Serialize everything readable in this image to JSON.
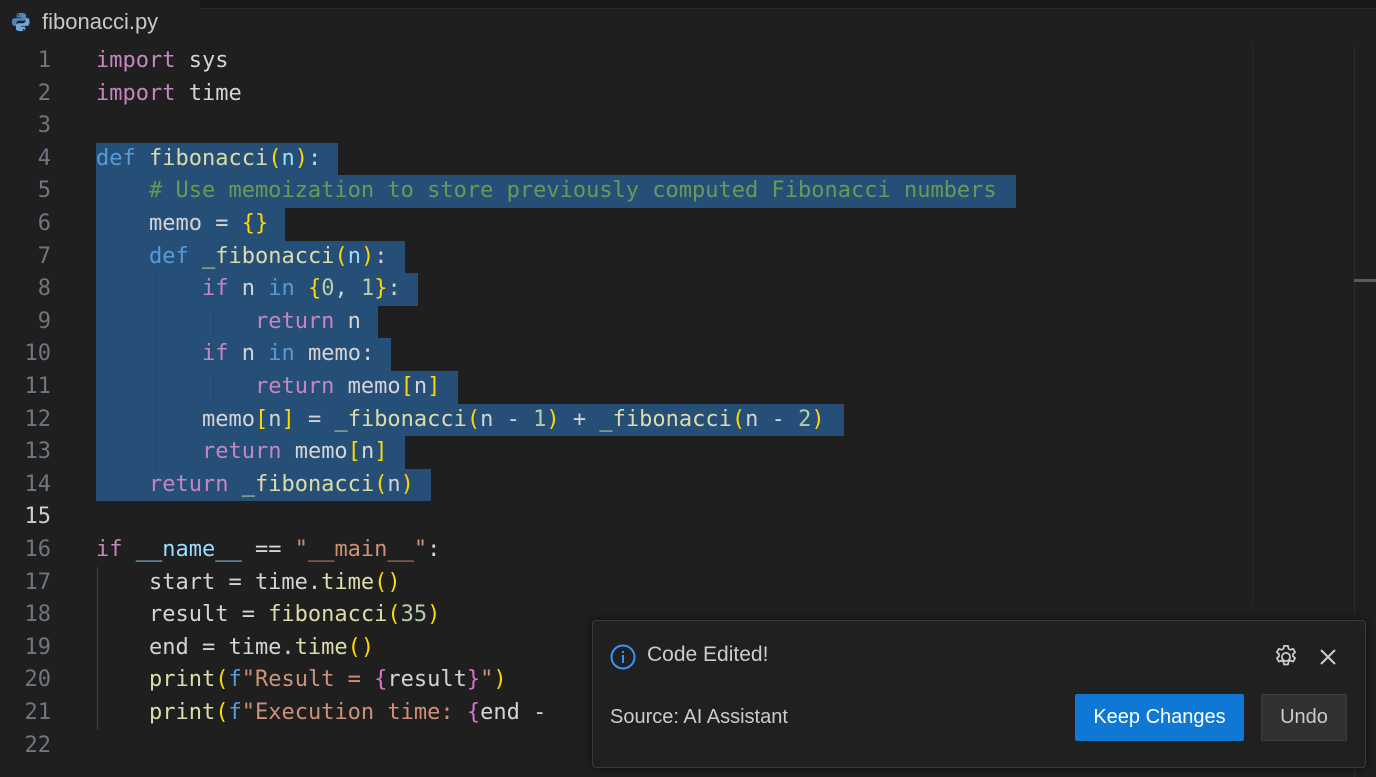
{
  "tab": {
    "filename": "fibonacci.py",
    "icon": "python-file-icon"
  },
  "editor": {
    "active_line": 15,
    "lines": [
      {
        "n": "1",
        "tokens": [
          [
            "kw",
            "import"
          ],
          [
            "",
            "&nbsp;sys"
          ]
        ]
      },
      {
        "n": "2",
        "tokens": [
          [
            "kw",
            "import"
          ],
          [
            "",
            "&nbsp;time"
          ]
        ]
      },
      {
        "n": "3",
        "tokens": []
      },
      {
        "n": "4",
        "tokens": [
          [
            "kwb",
            "def"
          ],
          [
            "",
            ""
          ],
          [
            "fn",
            "&nbsp;fibonacci"
          ],
          [
            "br1",
            "("
          ],
          [
            "var",
            "n"
          ],
          [
            "br1",
            ")"
          ],
          [
            "",
            ":"
          ]
        ]
      },
      {
        "n": "5",
        "tokens": [
          [
            "cm",
            "&nbsp;&nbsp;&nbsp;&nbsp;# Use memoization to store previously computed Fibonacci numbers"
          ]
        ]
      },
      {
        "n": "6",
        "tokens": [
          [
            "",
            "&nbsp;&nbsp;&nbsp;&nbsp;memo = "
          ],
          [
            "br1",
            "{}"
          ]
        ]
      },
      {
        "n": "7",
        "tokens": [
          [
            "",
            "&nbsp;&nbsp;&nbsp;&nbsp;"
          ],
          [
            "kwb",
            "def"
          ],
          [
            "fn",
            "&nbsp;_fibonacci"
          ],
          [
            "br1",
            "("
          ],
          [
            "var",
            "n"
          ],
          [
            "br1",
            ")"
          ],
          [
            "",
            ":"
          ]
        ]
      },
      {
        "n": "8",
        "tokens": [
          [
            "",
            "&nbsp;&nbsp;&nbsp;&nbsp;&nbsp;&nbsp;&nbsp;&nbsp;"
          ],
          [
            "kw",
            "if"
          ],
          [
            "",
            "&nbsp;n&nbsp;"
          ],
          [
            "kwb",
            "in"
          ],
          [
            "",
            "&nbsp;"
          ],
          [
            "br1",
            "{"
          ],
          [
            "num",
            "0"
          ],
          [
            "",
            ",&nbsp;"
          ],
          [
            "num",
            "1"
          ],
          [
            "br1",
            "}"
          ],
          [
            "",
            ":"
          ]
        ]
      },
      {
        "n": "9",
        "tokens": [
          [
            "",
            "&nbsp;&nbsp;&nbsp;&nbsp;&nbsp;&nbsp;&nbsp;&nbsp;&nbsp;&nbsp;&nbsp;&nbsp;"
          ],
          [
            "kw",
            "return"
          ],
          [
            "",
            "&nbsp;n"
          ]
        ]
      },
      {
        "n": "10",
        "tokens": [
          [
            "",
            "&nbsp;&nbsp;&nbsp;&nbsp;&nbsp;&nbsp;&nbsp;&nbsp;"
          ],
          [
            "kw",
            "if"
          ],
          [
            "",
            "&nbsp;n&nbsp;"
          ],
          [
            "kwb",
            "in"
          ],
          [
            "",
            "&nbsp;memo:"
          ]
        ]
      },
      {
        "n": "11",
        "tokens": [
          [
            "",
            "&nbsp;&nbsp;&nbsp;&nbsp;&nbsp;&nbsp;&nbsp;&nbsp;&nbsp;&nbsp;&nbsp;&nbsp;"
          ],
          [
            "kw",
            "return"
          ],
          [
            "",
            "&nbsp;memo"
          ],
          [
            "br1",
            "["
          ],
          [
            "",
            "n"
          ],
          [
            "br1",
            "]"
          ]
        ]
      },
      {
        "n": "12",
        "tokens": [
          [
            "",
            "&nbsp;&nbsp;&nbsp;&nbsp;&nbsp;&nbsp;&nbsp;&nbsp;memo"
          ],
          [
            "br1",
            "["
          ],
          [
            "",
            "n"
          ],
          [
            "br1",
            "]"
          ],
          [
            "",
            "&nbsp;=&nbsp;"
          ],
          [
            "fn",
            "_fibonacci"
          ],
          [
            "br1",
            "("
          ],
          [
            "",
            "n - "
          ],
          [
            "num",
            "1"
          ],
          [
            "br1",
            ")"
          ],
          [
            "",
            "&nbsp;+&nbsp;"
          ],
          [
            "fn",
            "_fibonacci"
          ],
          [
            "br1",
            "("
          ],
          [
            "",
            "n - "
          ],
          [
            "num",
            "2"
          ],
          [
            "br1",
            ")"
          ]
        ]
      },
      {
        "n": "13",
        "tokens": [
          [
            "",
            "&nbsp;&nbsp;&nbsp;&nbsp;&nbsp;&nbsp;&nbsp;&nbsp;"
          ],
          [
            "kw",
            "return"
          ],
          [
            "",
            "&nbsp;memo"
          ],
          [
            "br1",
            "["
          ],
          [
            "",
            "n"
          ],
          [
            "br1",
            "]"
          ]
        ]
      },
      {
        "n": "14",
        "tokens": [
          [
            "",
            "&nbsp;&nbsp;&nbsp;&nbsp;"
          ],
          [
            "kw",
            "return"
          ],
          [
            "fn",
            "&nbsp;_fibonacci"
          ],
          [
            "br1",
            "("
          ],
          [
            "",
            "n"
          ],
          [
            "br1",
            ")"
          ]
        ]
      },
      {
        "n": "15",
        "tokens": []
      },
      {
        "n": "16",
        "tokens": [
          [
            "kw",
            "if"
          ],
          [
            "",
            "&nbsp;"
          ],
          [
            "var",
            "__name__"
          ],
          [
            "",
            "&nbsp;==&nbsp;"
          ],
          [
            "str",
            "\"__main__\""
          ],
          [
            "",
            ":"
          ]
        ]
      },
      {
        "n": "17",
        "tokens": [
          [
            "",
            "&nbsp;&nbsp;&nbsp;&nbsp;start = time."
          ],
          [
            "fn",
            "time"
          ],
          [
            "br1",
            "()"
          ]
        ]
      },
      {
        "n": "18",
        "tokens": [
          [
            "",
            "&nbsp;&nbsp;&nbsp;&nbsp;result = "
          ],
          [
            "fn",
            "fibonacci"
          ],
          [
            "br1",
            "("
          ],
          [
            "num",
            "35"
          ],
          [
            "br1",
            ")"
          ]
        ]
      },
      {
        "n": "19",
        "tokens": [
          [
            "",
            "&nbsp;&nbsp;&nbsp;&nbsp;end = time."
          ],
          [
            "fn",
            "time"
          ],
          [
            "br1",
            "()"
          ]
        ]
      },
      {
        "n": "20",
        "tokens": [
          [
            "",
            "&nbsp;&nbsp;&nbsp;&nbsp;"
          ],
          [
            "fn",
            "print"
          ],
          [
            "br1",
            "("
          ],
          [
            "kwb",
            "f"
          ],
          [
            "str",
            "\"Result = "
          ],
          [
            "br2",
            "{"
          ],
          [
            "",
            "result"
          ],
          [
            "br2",
            "}"
          ],
          [
            "str",
            "\""
          ],
          [
            "br1",
            ")"
          ]
        ]
      },
      {
        "n": "21",
        "tokens": [
          [
            "",
            "&nbsp;&nbsp;&nbsp;&nbsp;"
          ],
          [
            "fn",
            "print"
          ],
          [
            "br1",
            "("
          ],
          [
            "kwb",
            "f"
          ],
          [
            "str",
            "\"Execution time: "
          ],
          [
            "br2",
            "{"
          ],
          [
            "",
            "end -"
          ]
        ]
      },
      {
        "n": "22",
        "tokens": []
      }
    ],
    "selection_lines": [
      4,
      5,
      6,
      7,
      8,
      9,
      10,
      11,
      12,
      13,
      14
    ]
  },
  "notification": {
    "title": "Code Edited!",
    "source": "Source: AI Assistant",
    "keep_label": "Keep Changes",
    "undo_label": "Undo",
    "info_icon": "info-icon",
    "gear_icon": "gear-icon",
    "close_icon": "close-icon"
  }
}
